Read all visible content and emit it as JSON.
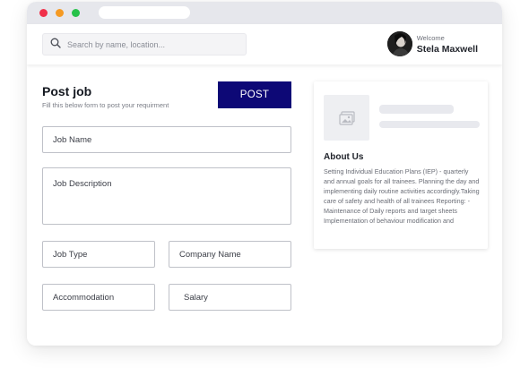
{
  "search": {
    "placeholder": "Search by name, location..."
  },
  "user": {
    "welcome": "Welcome",
    "name": "Stela Maxwell"
  },
  "form": {
    "title": "Post job",
    "subtitle": "Fill this below form to post your requirment",
    "post_label": "POST",
    "fields": {
      "job_name": "Job Name",
      "job_description": "Job Description",
      "job_type": "Job Type",
      "company_name": "Company Name",
      "accommodation": "Accommodation",
      "salary": "Salary"
    }
  },
  "about": {
    "title": "About Us",
    "text": "Setting Individual Education Plans (IEP) - quarterly and annual goals for all trainees. Planning the day and implementing daily routine activities accordingly.Taking care of safety and health of all trainees Reporting: - Maintenance of Daily reports and target sheets Implementation of behaviour modification and"
  },
  "icons": {
    "search": "search-icon",
    "image": "image-placeholder-icon"
  },
  "colors": {
    "post_button": "#0d0876",
    "dot_red": "#f0304a",
    "dot_yellow": "#f59a23",
    "dot_green": "#27c24a"
  }
}
